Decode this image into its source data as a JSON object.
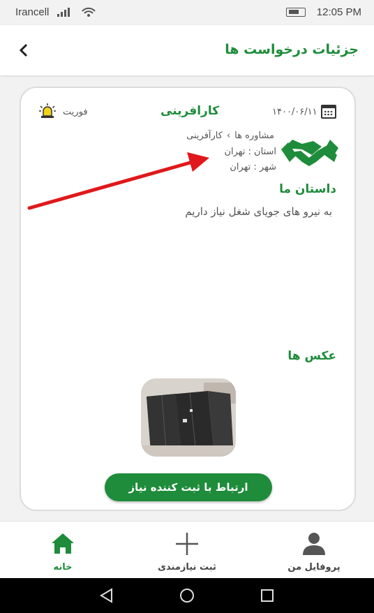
{
  "status_bar": {
    "carrier": "Irancell",
    "time": "12:05 PM"
  },
  "header": {
    "title": "جزئیات درخواست ها",
    "back_icon": "chevron-left-icon"
  },
  "request": {
    "date": "۱۴۰۰/۰۶/۱۱",
    "category": "کارافرینی",
    "urgency": "فوریت",
    "breadcrumb": {
      "parent": "مشاوره ها",
      "separator": "›",
      "child": "کارآفرینی"
    },
    "province": "استان : تهران",
    "city": "شهر : تهران",
    "story_title": "داستان ما",
    "story_text": "به نیرو های جویای شغل نیاز داریم",
    "photos_title": "عکس ها",
    "contact_button": "ارتباط با ثبت کننده نیاز"
  },
  "bottom_nav": {
    "items": [
      {
        "label": "پروفایل من",
        "icon": "person-icon"
      },
      {
        "label": "ثبت نیازمندی",
        "icon": "plus-icon"
      },
      {
        "label": "خانه",
        "icon": "home-icon",
        "active": true
      }
    ]
  },
  "colors": {
    "accent": "#1e8c3a",
    "annotation_arrow": "#e0181b"
  }
}
